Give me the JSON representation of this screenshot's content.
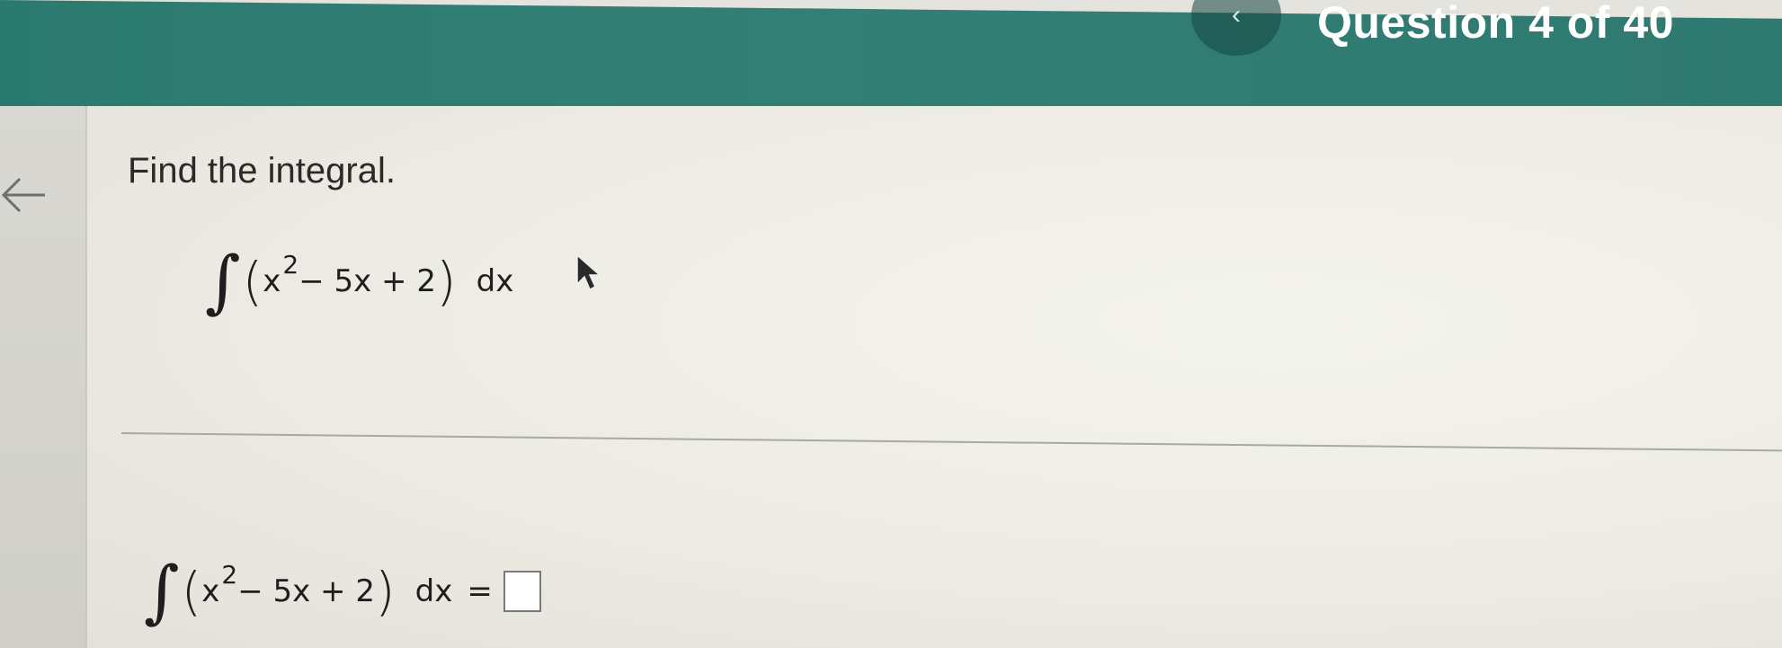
{
  "header": {
    "nav_back_glyph": "‹",
    "question_counter": "Question 4 of 40",
    "color": "#2f7a70"
  },
  "question": {
    "prompt": "Find the integral.",
    "integral_sign": "∫",
    "open_paren": "(",
    "base": "x",
    "exponent": "2",
    "rest": " − 5x + 2",
    "close_paren": ")",
    "differential": "dx"
  },
  "answer": {
    "integral_sign": "∫",
    "open_paren": "(",
    "base": "x",
    "exponent": "2",
    "rest": " − 5x + 2",
    "close_paren": ")",
    "differential": "dx",
    "equals": "=",
    "input_value": ""
  },
  "icons": {
    "back": "arrow-left-icon",
    "nav": "chevron-left-icon",
    "pointer": "mouse-pointer-icon"
  }
}
